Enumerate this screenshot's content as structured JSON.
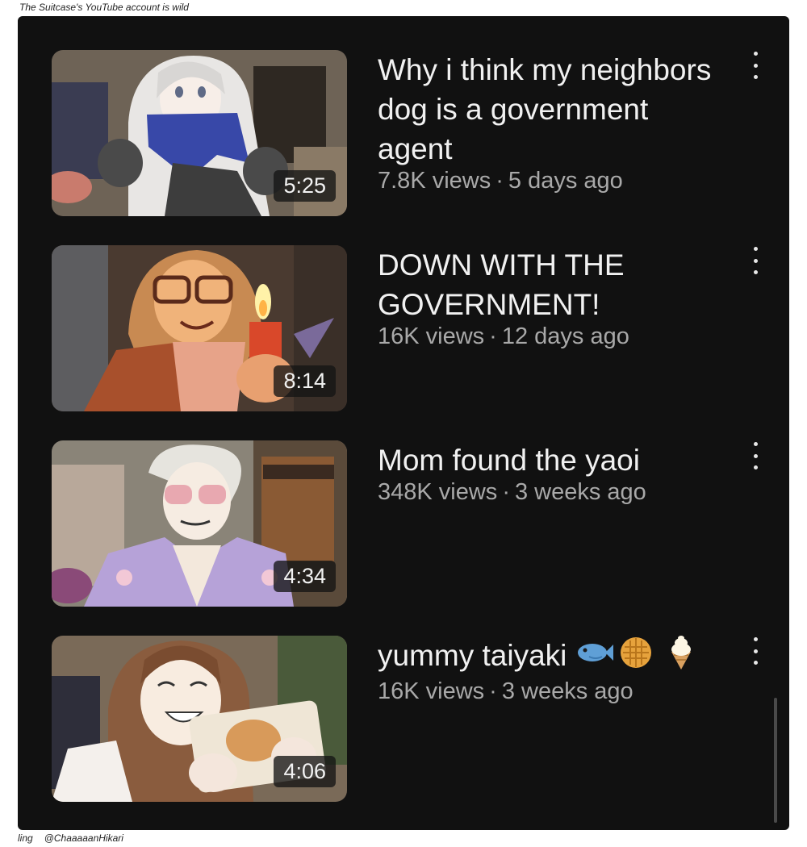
{
  "captions": {
    "top": "The Suitcase's YouTube account is wild",
    "bottom_left": "ling",
    "bottom_handle": "@ChaaaaanHikari"
  },
  "videos": [
    {
      "title": "Why i think my neighbors dog is a government agent",
      "views": "7.8K views",
      "age": "5 days ago",
      "duration": "5:25"
    },
    {
      "title": "DOWN WITH THE GOVERNMENT!",
      "views": "16K views",
      "age": "12 days ago",
      "duration": "8:14"
    },
    {
      "title": "Mom found the yaoi",
      "views": "348K views",
      "age": "3 weeks ago",
      "duration": "4:34"
    },
    {
      "title": "yummy taiyaki",
      "title_emojis": [
        "fish-emoji",
        "waffle-emoji",
        "ice-cream-emoji"
      ],
      "views": "16K views",
      "age": "3 weeks ago",
      "duration": "4:06"
    }
  ],
  "separator": "·",
  "colors": {
    "background": "#111111",
    "title": "#f1f1f1",
    "meta": "#a9a9a9"
  }
}
